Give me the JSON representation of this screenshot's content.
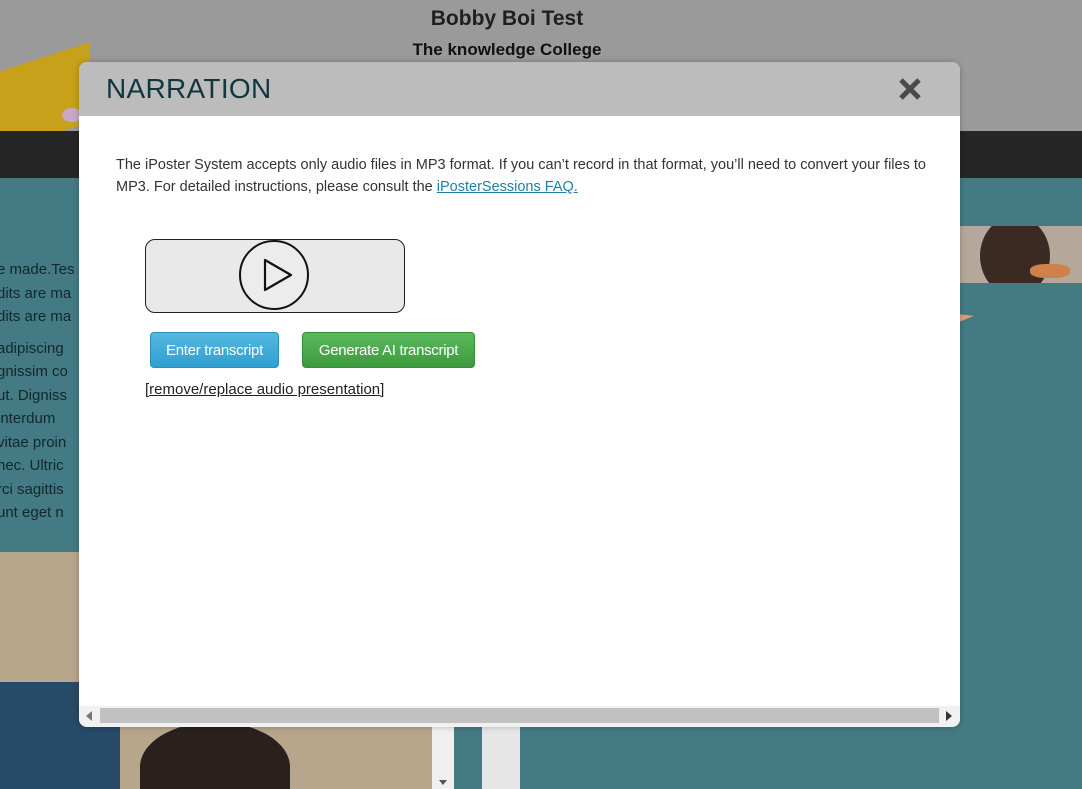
{
  "background": {
    "poster_title": "Bobby Boi Test",
    "poster_subtitle": "The knowledge College",
    "text_lines": [
      "e made.Tes",
      "dits are ma",
      "dits are ma",
      " adipiscing",
      "gnissim co",
      "ut. Digniss",
      " interdum",
      " vitae proin",
      " nec. Ultric",
      "rci sagittis",
      "unt eget n"
    ]
  },
  "modal": {
    "title": "NARRATION",
    "close_icon": "close-x-icon",
    "description_part1": "The iPoster System accepts only audio files in MP3 format. If you can’t record in that format, you’ll need to convert your files to MP3. For detailed instructions, please consult the ",
    "faq_link": "iPosterSessions FAQ.",
    "player": {
      "play_icon": "play-icon"
    },
    "buttons": {
      "enter_transcript": "Enter transcript",
      "generate_ai": "Generate AI transcript"
    },
    "remove_link": "[remove/replace audio presentation]"
  },
  "colors": {
    "header_bg": "#bcbcbc",
    "title": "#12363d",
    "link": "#1f7fa8",
    "btn_blue": "#2f9fd0",
    "btn_green": "#3d9a3d",
    "page_teal": "#447a84"
  }
}
